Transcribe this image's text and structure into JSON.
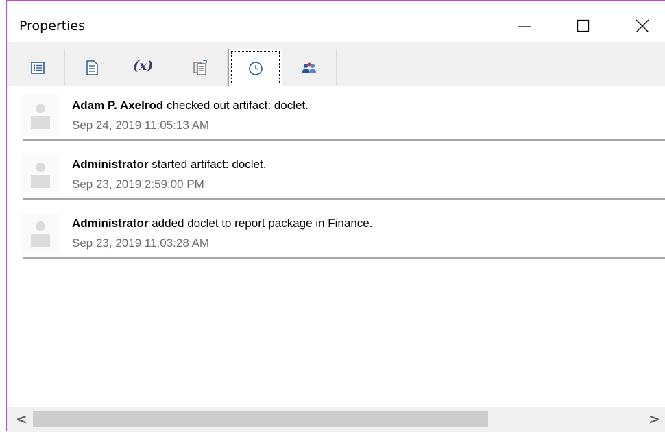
{
  "window": {
    "title": "Properties",
    "controls": [
      "minimize",
      "maximize",
      "close"
    ]
  },
  "toolbar": {
    "tabs": [
      {
        "name": "list-view",
        "icon": "list-icon",
        "active": false
      },
      {
        "name": "document",
        "icon": "document-icon",
        "active": false
      },
      {
        "name": "variables",
        "icon": "variables-icon",
        "label": "(x)",
        "active": false
      },
      {
        "name": "report-package",
        "icon": "report-icon",
        "active": false
      },
      {
        "name": "history",
        "icon": "clock-icon",
        "active": true
      },
      {
        "name": "users",
        "icon": "users-icon",
        "active": false
      }
    ]
  },
  "activity": {
    "entries": [
      {
        "user": "Adam P. Axelrod",
        "action": "checked out artifact: doclet.",
        "timestamp": "Sep 24, 2019 11:05:13 AM"
      },
      {
        "user": "Administrator",
        "action": "started artifact: doclet.",
        "timestamp": "Sep 23, 2019 2:59:00 PM"
      },
      {
        "user": "Administrator",
        "action": "added doclet to report package in Finance.",
        "timestamp": "Sep 23, 2019 11:03:28 AM"
      }
    ]
  },
  "scrollbar": {
    "left_arrow": "<",
    "right_arrow": ">",
    "thumb_fraction": 0.7
  },
  "colors": {
    "window_border": "#c64ad0",
    "toolbar_bg": "#f0f0f0",
    "timestamp": "#6d6d6d",
    "icon_blue": "#2b579a"
  }
}
